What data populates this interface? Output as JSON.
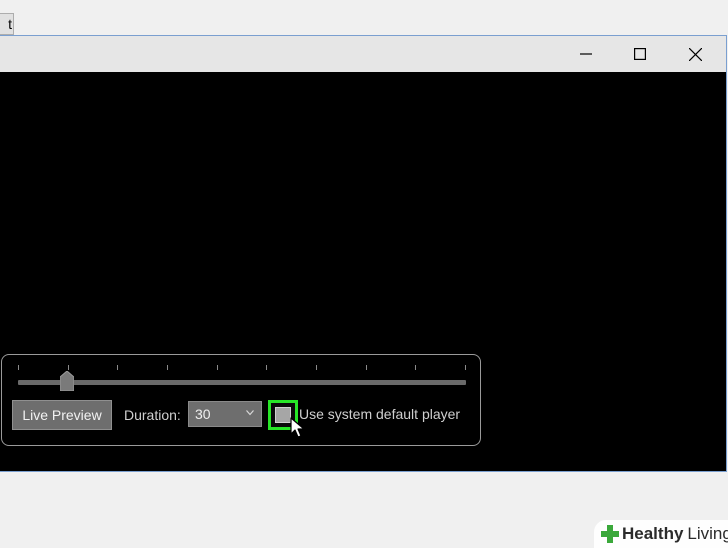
{
  "background_tab": {
    "label": "t"
  },
  "titlebar": {
    "minimize_glyph": "—",
    "maximize_glyph": "☐",
    "close_glyph": "✕"
  },
  "controls": {
    "live_preview_label": "Live Preview",
    "duration_label": "Duration:",
    "duration_value": "30",
    "checkbox_label": "Use system default player",
    "checkbox_checked": false,
    "slider_position": 0.11,
    "slider_tick_count": 10
  },
  "colors": {
    "highlight": "#27e627",
    "window_border": "#7a9fd0",
    "brand_green": "#3aa83a"
  },
  "branding": {
    "name_bold": "Healthy",
    "name_regular": "Living"
  }
}
